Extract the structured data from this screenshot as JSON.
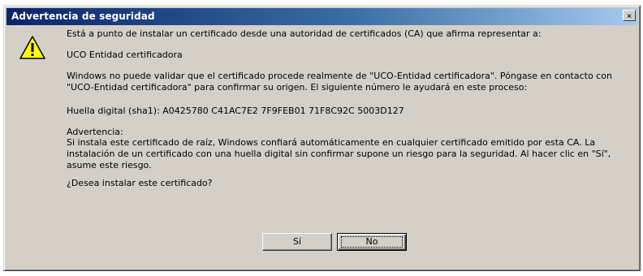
{
  "window": {
    "title": "Advertencia de seguridad",
    "close_glyph": "×"
  },
  "icons": {
    "warning": "warning-triangle-icon"
  },
  "message": {
    "intro": "Está a punto de instalar un certificado desde una autoridad de certificados (CA) que afirma representar a:",
    "issuer": "UCO Entidad certificadora",
    "validate": "Windows no puede validar que el certificado procede realmente de \"UCO-Entidad certificadora\". Póngase en contacto con \"UCO-Entidad certificadora\" para confirmar su origen. El siguiente número le ayudará en este proceso:",
    "thumbprint": "Huella digital (sha1): A0425780 C41AC7E2 7F9FEB01 71F8C92C 5003D127",
    "warning_title": "Advertencia:",
    "warning_body": "Si instala este certificado de raíz, Windows confiará automáticamente en cualquier certificado emitido por esta CA. La instalación de un certificado con una huella digital sin confirmar supone un riesgo para la seguridad. Al hacer clic en \"Sí\", asume este riesgo.",
    "question": "¿Desea instalar este certificado?"
  },
  "buttons": {
    "yes": "Sí",
    "no": "No"
  }
}
